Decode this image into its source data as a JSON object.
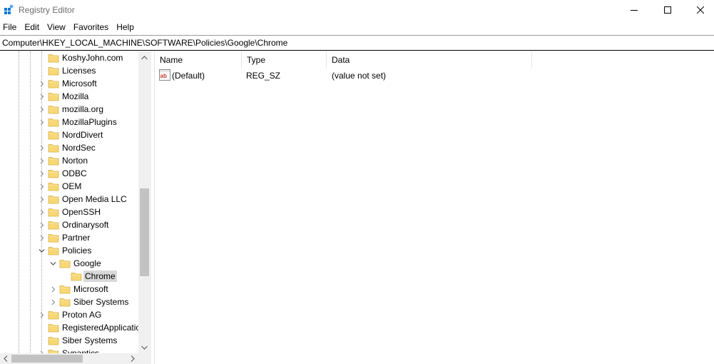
{
  "window": {
    "title": "Registry Editor"
  },
  "menu": [
    "File",
    "Edit",
    "View",
    "Favorites",
    "Help"
  ],
  "address": "Computer\\HKEY_LOCAL_MACHINE\\SOFTWARE\\Policies\\Google\\Chrome",
  "tree": {
    "items": [
      {
        "label": "KoshyJohn.com",
        "expander": "none",
        "selected": false
      },
      {
        "label": "Licenses",
        "expander": "none",
        "selected": false
      },
      {
        "label": "Microsoft",
        "expander": "collapsed",
        "selected": false
      },
      {
        "label": "Mozilla",
        "expander": "collapsed",
        "selected": false
      },
      {
        "label": "mozilla.org",
        "expander": "collapsed",
        "selected": false
      },
      {
        "label": "MozillaPlugins",
        "expander": "collapsed",
        "selected": false
      },
      {
        "label": "NordDivert",
        "expander": "none",
        "selected": false
      },
      {
        "label": "NordSec",
        "expander": "collapsed",
        "selected": false
      },
      {
        "label": "Norton",
        "expander": "collapsed",
        "selected": false
      },
      {
        "label": "ODBC",
        "expander": "collapsed",
        "selected": false
      },
      {
        "label": "OEM",
        "expander": "collapsed",
        "selected": false
      },
      {
        "label": "Open Media LLC",
        "expander": "collapsed",
        "selected": false
      },
      {
        "label": "OpenSSH",
        "expander": "collapsed",
        "selected": false
      },
      {
        "label": "Ordinarysoft",
        "expander": "collapsed",
        "selected": false
      },
      {
        "label": "Partner",
        "expander": "collapsed",
        "selected": false
      },
      {
        "label": "Policies",
        "expander": "expanded",
        "selected": false
      },
      {
        "label": "Google",
        "expander": "expanded",
        "selected": false
      },
      {
        "label": "Chrome",
        "expander": "none",
        "selected": true
      },
      {
        "label": "Microsoft",
        "expander": "collapsed",
        "selected": false
      },
      {
        "label": "Siber Systems",
        "expander": "collapsed",
        "selected": false
      },
      {
        "label": "Proton AG",
        "expander": "collapsed",
        "selected": false
      },
      {
        "label": "RegisteredApplications",
        "expander": "none",
        "selected": false
      },
      {
        "label": "Siber Systems",
        "expander": "none",
        "selected": false
      },
      {
        "label": "Synaptics",
        "expander": "collapsed",
        "selected": false
      }
    ]
  },
  "list": {
    "columns": [
      "Name",
      "Type",
      "Data"
    ],
    "rows": [
      {
        "icon": "string-value-icon",
        "name": "(Default)",
        "type": "REG_SZ",
        "data": "(value not set)"
      }
    ]
  },
  "colors": {
    "folder": "#f8d775",
    "folder_edge": "#d8b24a",
    "selection": "#d9d9d9",
    "app_icon_blue": "#0078d7"
  }
}
